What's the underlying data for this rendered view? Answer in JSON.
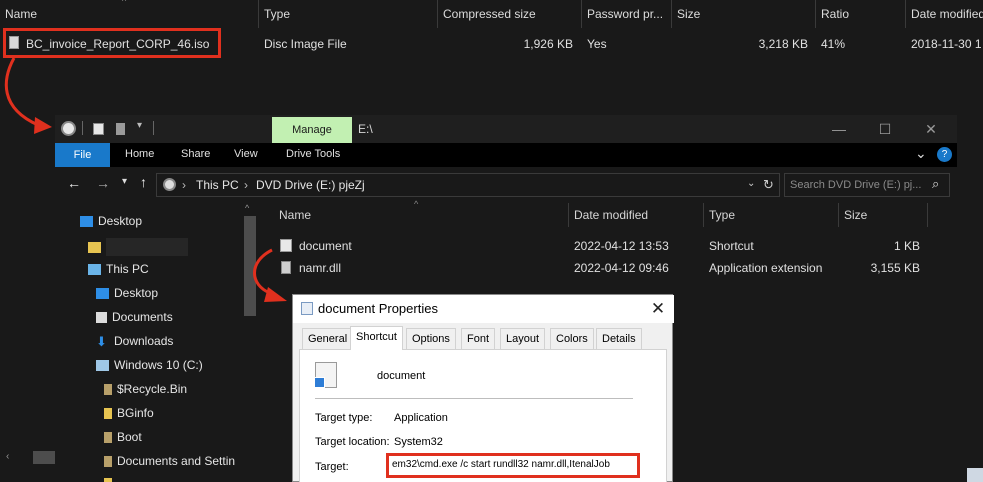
{
  "archive_list": {
    "columns": [
      "Name",
      "Type",
      "Compressed size",
      "Password pr...",
      "Size",
      "Ratio",
      "Date modified"
    ],
    "rows": [
      {
        "name": "BC_invoice_Report_CORP_46.iso",
        "type": "Disc Image File",
        "compressed_size": "1,926 KB",
        "password": "Yes",
        "size": "3,218 KB",
        "ratio": "41%",
        "date_modified": "2018-11-30 1"
      }
    ]
  },
  "explorer": {
    "context_tab": "Manage",
    "title_path": "E:\\",
    "ribbon_tabs": [
      "File",
      "Home",
      "Share",
      "View",
      "Drive Tools"
    ],
    "breadcrumb": [
      "This PC",
      "DVD Drive (E:) pjeZj"
    ],
    "search_placeholder": "Search DVD Drive (E:) pj...",
    "nav_items": [
      "Desktop",
      "",
      "This PC",
      "Desktop",
      "Documents",
      "Downloads",
      "Windows 10 (C:)",
      "$Recycle.Bin",
      "BGinfo",
      "Boot",
      "Documents and Settin"
    ],
    "file_columns": [
      "Name",
      "Date modified",
      "Type",
      "Size"
    ],
    "files": [
      {
        "name": "document",
        "date": "2022-04-12 13:53",
        "type": "Shortcut",
        "size": "1 KB"
      },
      {
        "name": "namr.dll",
        "date": "2022-04-12 09:46",
        "type": "Application extension",
        "size": "3,155 KB"
      }
    ]
  },
  "properties": {
    "title": "document Properties",
    "tabs": [
      "General",
      "Shortcut",
      "Options",
      "Font",
      "Layout",
      "Colors",
      "Details"
    ],
    "active_tab": "Shortcut",
    "item_name": "document",
    "target_type_label": "Target type:",
    "target_type_value": "Application",
    "target_location_label": "Target location:",
    "target_location_value": "System32",
    "target_label": "Target:",
    "target_value": "em32\\cmd.exe /c start rundll32 namr.dll,ItenalJob"
  },
  "colors": {
    "highlight_red": "#e0301e",
    "manage_tab": "#c2f0b2",
    "file_tab": "#1979ca"
  }
}
